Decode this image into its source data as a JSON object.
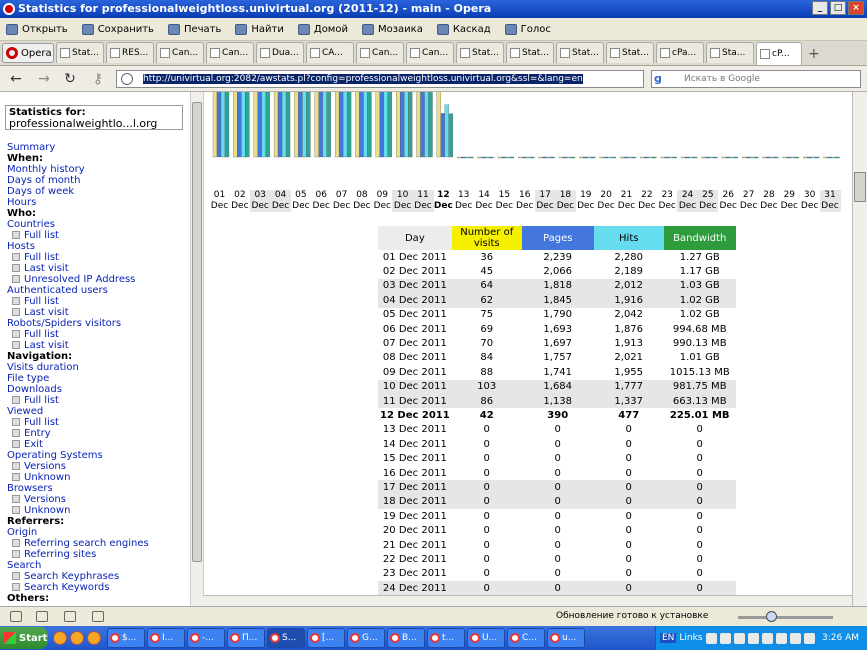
{
  "window": {
    "title": "Statistics for professionalweightloss.univirtual.org (2011-12) - main - Opera"
  },
  "menubar": [
    "Открыть",
    "Сохранить",
    "Печать",
    "Найти",
    "Домой",
    "Мозаика",
    "Каскад",
    "Голос"
  ],
  "opera_button": "Opera",
  "tabs": [
    "Stat...",
    "RES...",
    "Can...",
    "Can...",
    "Dua...",
    "CA...",
    "Can...",
    "Can...",
    "Stat...",
    "Stat...",
    "Stat...",
    "Stat...",
    "cPa...",
    "Sta...",
    "cP..."
  ],
  "address": {
    "url": "http://univirtual.org:2082/awstats.pl?config=professionalweightloss.univirtual.org&ssl=&lang=en",
    "search_placeholder": "Искать в Google"
  },
  "sidebar": {
    "stats_for_label": "Statistics for:",
    "domain": "professionalweightlo...l.org",
    "menu": [
      {
        "t": "Summary",
        "k": "lk"
      },
      {
        "t": "When:",
        "k": "hd"
      },
      {
        "t": "Monthly history",
        "k": "lk"
      },
      {
        "t": "Days of month",
        "k": "lk"
      },
      {
        "t": "Days of week",
        "k": "lk"
      },
      {
        "t": "Hours",
        "k": "lk"
      },
      {
        "t": "Who:",
        "k": "hd"
      },
      {
        "t": "Countries",
        "k": "lk"
      },
      {
        "t": "Full list",
        "k": "sub"
      },
      {
        "t": "Hosts",
        "k": "lk"
      },
      {
        "t": "Full list",
        "k": "sub"
      },
      {
        "t": "Last visit",
        "k": "sub"
      },
      {
        "t": "Unresolved IP Address",
        "k": "sub"
      },
      {
        "t": "Authenticated users",
        "k": "lk"
      },
      {
        "t": "Full list",
        "k": "sub"
      },
      {
        "t": "Last visit",
        "k": "sub"
      },
      {
        "t": "Robots/Spiders visitors",
        "k": "lk"
      },
      {
        "t": "Full list",
        "k": "sub"
      },
      {
        "t": "Last visit",
        "k": "sub"
      },
      {
        "t": "Navigation:",
        "k": "hd"
      },
      {
        "t": "Visits duration",
        "k": "lk"
      },
      {
        "t": "File type",
        "k": "lk"
      },
      {
        "t": "Downloads",
        "k": "lk"
      },
      {
        "t": "Full list",
        "k": "sub"
      },
      {
        "t": "Viewed",
        "k": "lk"
      },
      {
        "t": "Full list",
        "k": "sub"
      },
      {
        "t": "Entry",
        "k": "sub"
      },
      {
        "t": "Exit",
        "k": "sub"
      },
      {
        "t": "Operating Systems",
        "k": "lk"
      },
      {
        "t": "Versions",
        "k": "sub"
      },
      {
        "t": "Unknown",
        "k": "sub"
      },
      {
        "t": "Browsers",
        "k": "lk"
      },
      {
        "t": "Versions",
        "k": "sub"
      },
      {
        "t": "Unknown",
        "k": "sub"
      },
      {
        "t": "Referrers:",
        "k": "hd"
      },
      {
        "t": "Origin",
        "k": "lk"
      },
      {
        "t": "Referring search engines",
        "k": "sub"
      },
      {
        "t": "Referring sites",
        "k": "sub"
      },
      {
        "t": "Search",
        "k": "lk"
      },
      {
        "t": "Search Keyphrases",
        "k": "sub"
      },
      {
        "t": "Search Keywords",
        "k": "sub"
      },
      {
        "t": "Others:",
        "k": "hd"
      }
    ]
  },
  "chart_data": {
    "type": "bar",
    "month_label": "Dec",
    "days": [
      "01",
      "02",
      "03",
      "04",
      "05",
      "06",
      "07",
      "08",
      "09",
      "10",
      "11",
      "12",
      "13",
      "14",
      "15",
      "16",
      "17",
      "18",
      "19",
      "20",
      "21",
      "22",
      "23",
      "24",
      "25",
      "26",
      "27",
      "28",
      "29",
      "30",
      "31"
    ],
    "weekend_days": [
      "03",
      "04",
      "10",
      "11",
      "17",
      "18",
      "24",
      "25",
      "31"
    ],
    "today": "12",
    "series": [
      {
        "name": "Number of visits",
        "color": "#e8e089",
        "values": [
          36,
          45,
          64,
          62,
          75,
          69,
          70,
          84,
          88,
          103,
          86,
          42,
          0,
          0,
          0,
          0,
          0,
          0,
          0,
          0,
          0,
          0,
          0,
          0,
          0,
          0,
          0,
          0,
          0,
          0,
          0
        ]
      },
      {
        "name": "Pages",
        "color": "#4477dd",
        "values": [
          2239,
          2066,
          1818,
          1845,
          1790,
          1693,
          1697,
          1757,
          1741,
          1684,
          1138,
          390,
          0,
          0,
          0,
          0,
          0,
          0,
          0,
          0,
          0,
          0,
          0,
          0,
          0,
          0,
          0,
          0,
          0,
          0,
          0
        ]
      },
      {
        "name": "Hits",
        "color": "#66ddee",
        "values": [
          2280,
          2189,
          2012,
          1916,
          2042,
          1876,
          1913,
          2021,
          1955,
          1777,
          1337,
          477,
          0,
          0,
          0,
          0,
          0,
          0,
          0,
          0,
          0,
          0,
          0,
          0,
          0,
          0,
          0,
          0,
          0,
          0,
          0
        ]
      },
      {
        "name": "Bandwidth",
        "color": "#2ea495",
        "values": [
          "1.27 GB",
          "1.17 GB",
          "1.03 GB",
          "1.02 GB",
          "1.02 GB",
          "994.68 MB",
          "990.13 MB",
          "1.01 GB",
          "1015.13 MB",
          "981.75 MB",
          "663.13 MB",
          "225.01 MB",
          "0",
          "0",
          "0",
          "0",
          "0",
          "0",
          "0",
          "0",
          "0",
          "0",
          "0",
          "0",
          "0",
          "0",
          "0",
          "0",
          "0",
          "0",
          "0"
        ]
      }
    ]
  },
  "table": {
    "headers": {
      "day": "Day",
      "visits": "Number of visits",
      "pages": "Pages",
      "hits": "Hits",
      "bandwidth": "Bandwidth"
    },
    "header_colors": {
      "day": "#ececec",
      "visits": "#f4f000",
      "pages": "#4477dd",
      "hits": "#66ddee",
      "bandwidth": "#2e9b3c"
    },
    "rows": [
      {
        "day": "01 Dec 2011",
        "visits": "36",
        "pages": "2,239",
        "hits": "2,280",
        "bw": "1.27 GB"
      },
      {
        "day": "02 Dec 2011",
        "visits": "45",
        "pages": "2,066",
        "hits": "2,189",
        "bw": "1.17 GB"
      },
      {
        "day": "03 Dec 2011",
        "visits": "64",
        "pages": "1,818",
        "hits": "2,012",
        "bw": "1.03 GB",
        "we": true
      },
      {
        "day": "04 Dec 2011",
        "visits": "62",
        "pages": "1,845",
        "hits": "1,916",
        "bw": "1.02 GB",
        "we": true
      },
      {
        "day": "05 Dec 2011",
        "visits": "75",
        "pages": "1,790",
        "hits": "2,042",
        "bw": "1.02 GB"
      },
      {
        "day": "06 Dec 2011",
        "visits": "69",
        "pages": "1,693",
        "hits": "1,876",
        "bw": "994.68 MB"
      },
      {
        "day": "07 Dec 2011",
        "visits": "70",
        "pages": "1,697",
        "hits": "1,913",
        "bw": "990.13 MB"
      },
      {
        "day": "08 Dec 2011",
        "visits": "84",
        "pages": "1,757",
        "hits": "2,021",
        "bw": "1.01 GB"
      },
      {
        "day": "09 Dec 2011",
        "visits": "88",
        "pages": "1,741",
        "hits": "1,955",
        "bw": "1015.13 MB"
      },
      {
        "day": "10 Dec 2011",
        "visits": "103",
        "pages": "1,684",
        "hits": "1,777",
        "bw": "981.75 MB",
        "we": true
      },
      {
        "day": "11 Dec 2011",
        "visits": "86",
        "pages": "1,138",
        "hits": "1,337",
        "bw": "663.13 MB",
        "we": true
      },
      {
        "day": "12 Dec 2011",
        "visits": "42",
        "pages": "390",
        "hits": "477",
        "bw": "225.01 MB",
        "today": true
      },
      {
        "day": "13 Dec 2011",
        "visits": "0",
        "pages": "0",
        "hits": "0",
        "bw": "0"
      },
      {
        "day": "14 Dec 2011",
        "visits": "0",
        "pages": "0",
        "hits": "0",
        "bw": "0"
      },
      {
        "day": "15 Dec 2011",
        "visits": "0",
        "pages": "0",
        "hits": "0",
        "bw": "0"
      },
      {
        "day": "16 Dec 2011",
        "visits": "0",
        "pages": "0",
        "hits": "0",
        "bw": "0"
      },
      {
        "day": "17 Dec 2011",
        "visits": "0",
        "pages": "0",
        "hits": "0",
        "bw": "0",
        "we": true
      },
      {
        "day": "18 Dec 2011",
        "visits": "0",
        "pages": "0",
        "hits": "0",
        "bw": "0",
        "we": true
      },
      {
        "day": "19 Dec 2011",
        "visits": "0",
        "pages": "0",
        "hits": "0",
        "bw": "0"
      },
      {
        "day": "20 Dec 2011",
        "visits": "0",
        "pages": "0",
        "hits": "0",
        "bw": "0"
      },
      {
        "day": "21 Dec 2011",
        "visits": "0",
        "pages": "0",
        "hits": "0",
        "bw": "0"
      },
      {
        "day": "22 Dec 2011",
        "visits": "0",
        "pages": "0",
        "hits": "0",
        "bw": "0"
      },
      {
        "day": "23 Dec 2011",
        "visits": "0",
        "pages": "0",
        "hits": "0",
        "bw": "0"
      },
      {
        "day": "24 Dec 2011",
        "visits": "0",
        "pages": "0",
        "hits": "0",
        "bw": "0",
        "we": true
      }
    ]
  },
  "status": {
    "text": "Обновление готово к установке"
  },
  "taskbar": {
    "start": "Start",
    "items": [
      "$...",
      "I...",
      "-...",
      "П...",
      "S...",
      "[...",
      "G...",
      "B...",
      "t...",
      "U...",
      "C...",
      "u..."
    ],
    "links": "Links",
    "lang": "EN",
    "clock": "3:26 AM"
  }
}
